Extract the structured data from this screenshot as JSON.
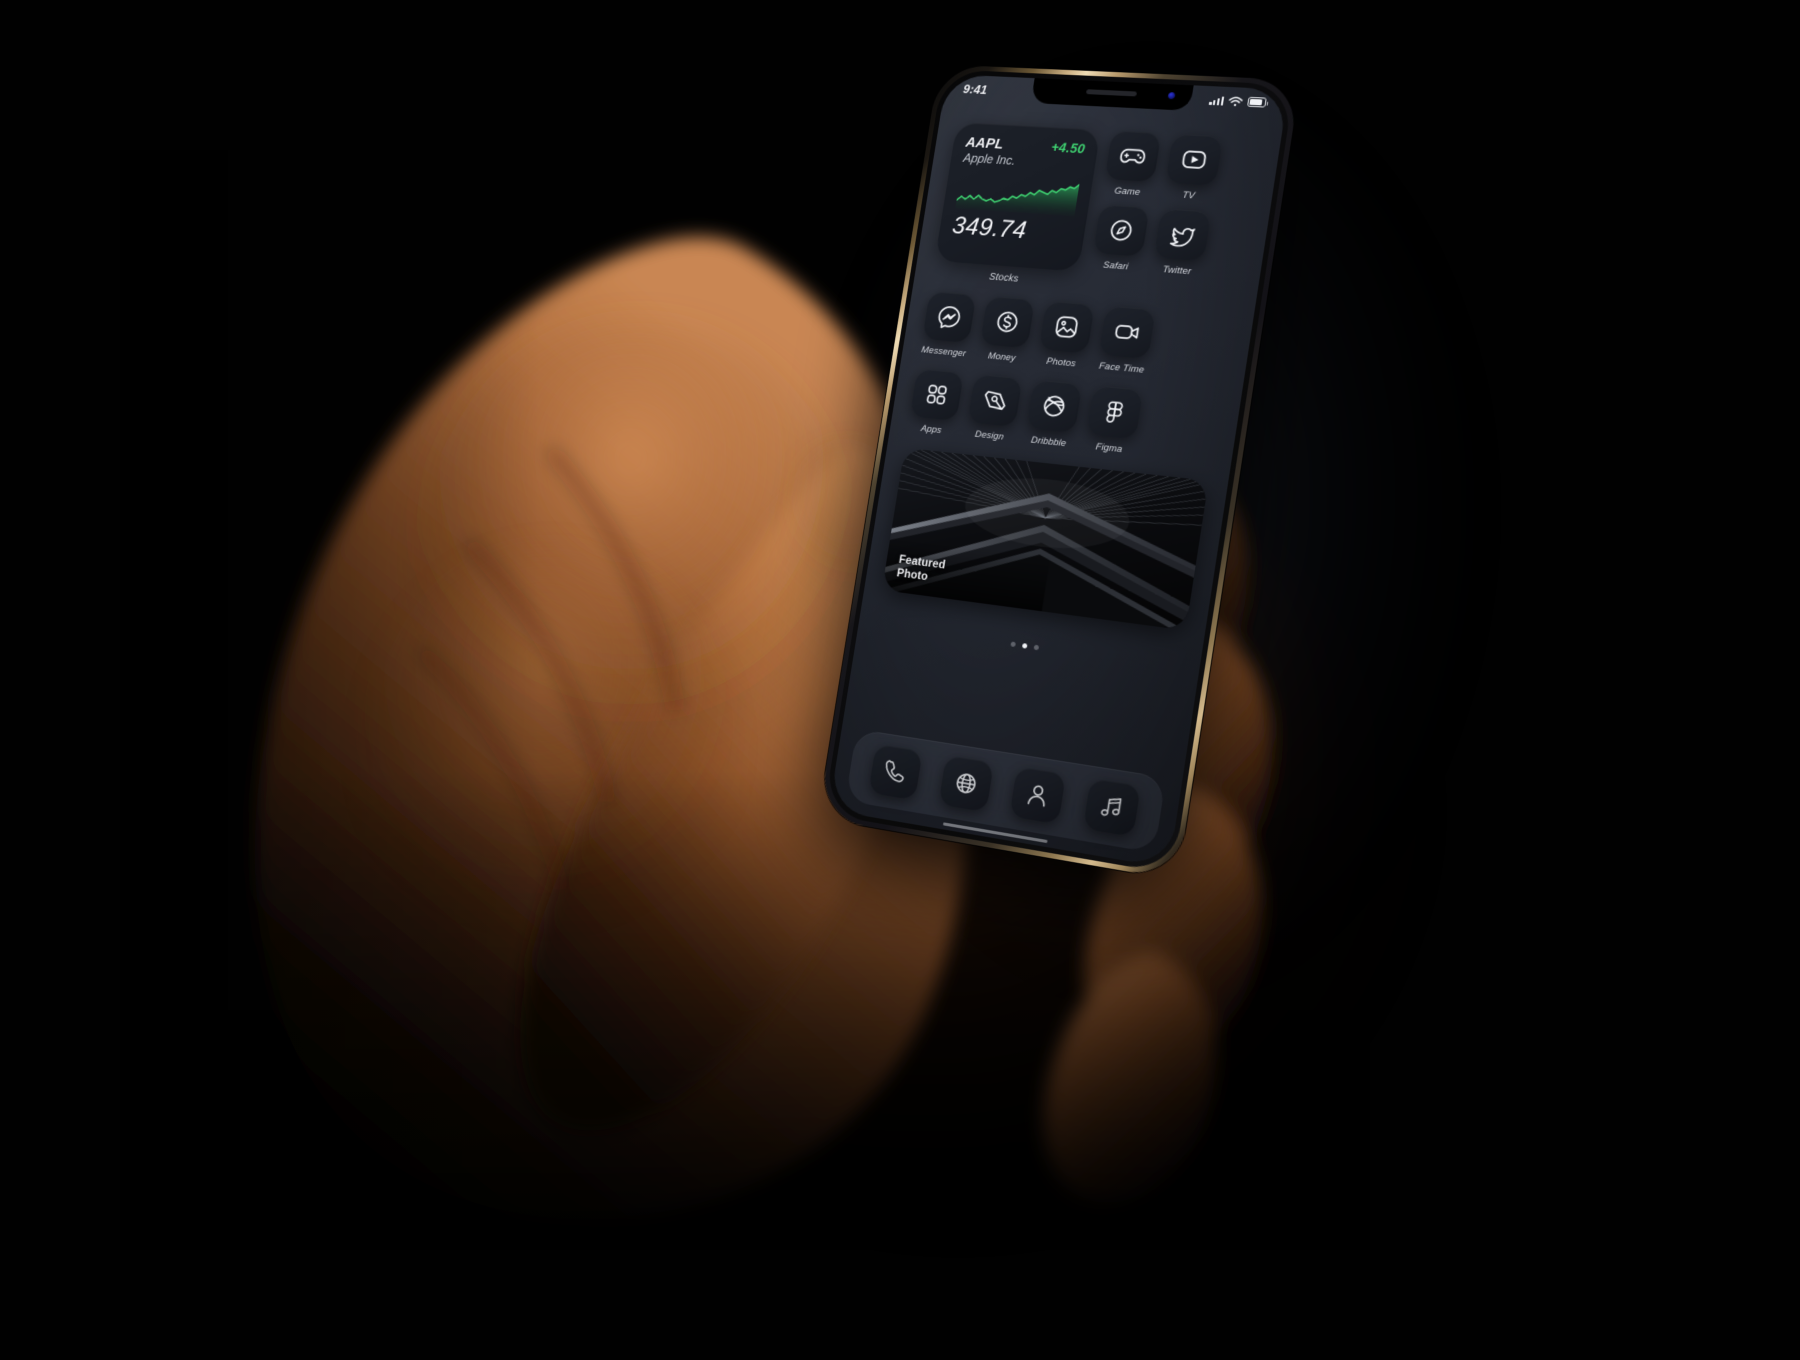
{
  "scene": {
    "background_color": "#010101",
    "description": "Hand holding an iPhone with a dark themed home screen",
    "device_frame_color": "#d4ba8d",
    "wallpaper_color": "#262a34"
  },
  "status_bar": {
    "time": "9:41",
    "cellular_icon": "signal-bars-icon",
    "cellular_bars": 4,
    "wifi_icon": "wifi-icon",
    "battery_icon": "battery-icon",
    "battery_level_pct": 72
  },
  "widgets": {
    "stocks": {
      "label": "Stocks",
      "symbol": "AAPL",
      "change": "+4.50",
      "change_color": "#3fd271",
      "company": "Apple Inc.",
      "price": "349.74"
    },
    "featured_photo": {
      "caption_line1": "Featured",
      "caption_line2": "Photo"
    }
  },
  "chart_data": {
    "type": "line",
    "title": "AAPL",
    "subtitle": "Apple Inc.",
    "xlabel": "",
    "ylabel": "",
    "series": [
      {
        "name": "AAPL",
        "color": "#3fd271",
        "values": [
          18,
          30,
          22,
          34,
          24,
          36,
          26,
          21,
          28,
          19,
          24,
          32,
          28,
          40,
          35,
          46,
          42,
          54,
          48,
          62,
          57,
          52,
          64,
          59,
          71,
          68,
          78,
          74,
          86
        ]
      }
    ],
    "ylim": [
      0,
      100
    ],
    "grid": false,
    "legend": "none",
    "area_fill": true
  },
  "apps": {
    "top_right": [
      {
        "label": "Game",
        "icon": "gamepad-icon"
      },
      {
        "label": "TV",
        "icon": "tv-play-icon"
      },
      {
        "label": "Safari",
        "icon": "compass-icon"
      },
      {
        "label": "Twitter",
        "icon": "twitter-bird-icon"
      }
    ],
    "row3": [
      {
        "label": "Messenger",
        "icon": "messenger-icon"
      },
      {
        "label": "Money",
        "icon": "dollar-coin-icon"
      },
      {
        "label": "Photos",
        "icon": "photo-icon"
      },
      {
        "label": "Face Time",
        "icon": "video-camera-icon"
      }
    ],
    "row4": [
      {
        "label": "Apps",
        "icon": "grid-squares-icon"
      },
      {
        "label": "Design",
        "icon": "pen-nib-icon"
      },
      {
        "label": "Dribbble",
        "icon": "dribbble-ball-icon"
      },
      {
        "label": "Figma",
        "icon": "figma-icon"
      }
    ]
  },
  "page_dots": {
    "count": 3,
    "active_index": 1
  },
  "dock": [
    {
      "label": "Phone",
      "icon": "phone-icon"
    },
    {
      "label": "Browser",
      "icon": "globe-icon"
    },
    {
      "label": "Contacts",
      "icon": "person-icon"
    },
    {
      "label": "Music",
      "icon": "music-note-icon"
    }
  ]
}
